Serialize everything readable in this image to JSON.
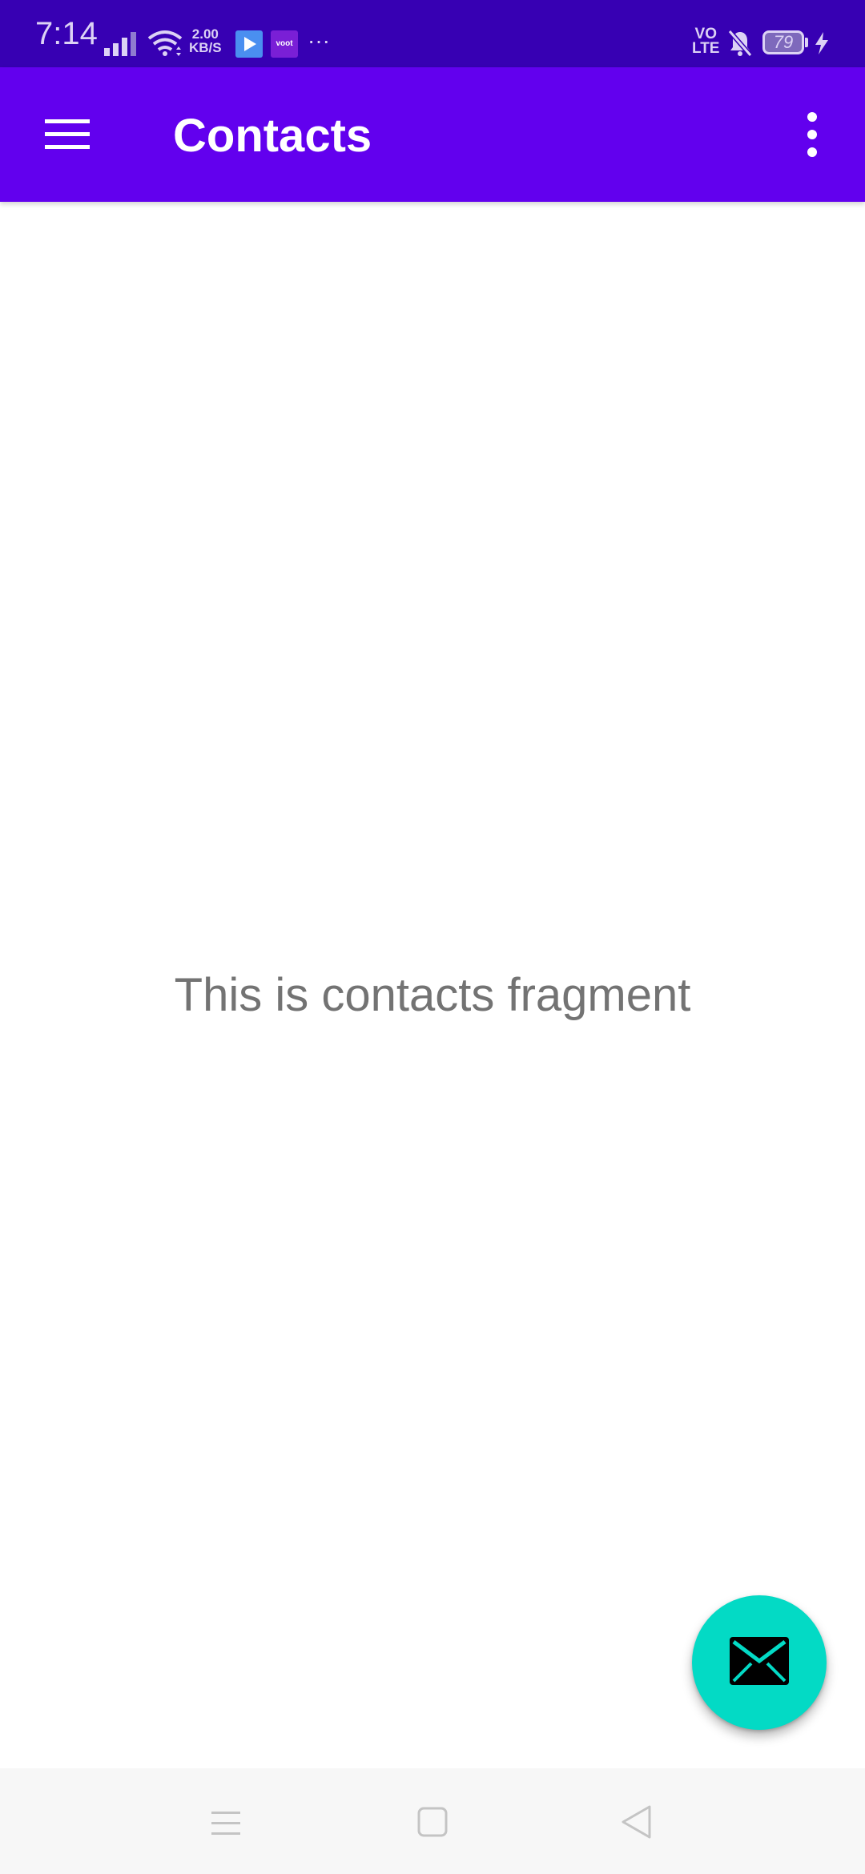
{
  "status_bar": {
    "time": "7:14",
    "speed_value": "2.00",
    "speed_unit": "KB/S",
    "app_icons": [
      "play-store-icon",
      "voot-icon"
    ],
    "voot_label": "voot",
    "more_notifications": "···",
    "volte_top": "VO",
    "volte_bottom": "LTE",
    "battery_level": "79"
  },
  "app_bar": {
    "title": "Contacts",
    "menu_icon": "hamburger-menu-icon",
    "overflow_icon": "more-vertical-icon",
    "background_color": "#6200ee"
  },
  "content": {
    "message": "This is contacts fragment"
  },
  "fab": {
    "icon": "email-icon",
    "background_color": "#03dac5"
  },
  "nav_bar": {
    "buttons": [
      "recents-icon",
      "home-icon",
      "back-icon"
    ]
  },
  "colors": {
    "status_bar": "#3700b3",
    "primary": "#6200ee",
    "accent": "#03dac5"
  }
}
